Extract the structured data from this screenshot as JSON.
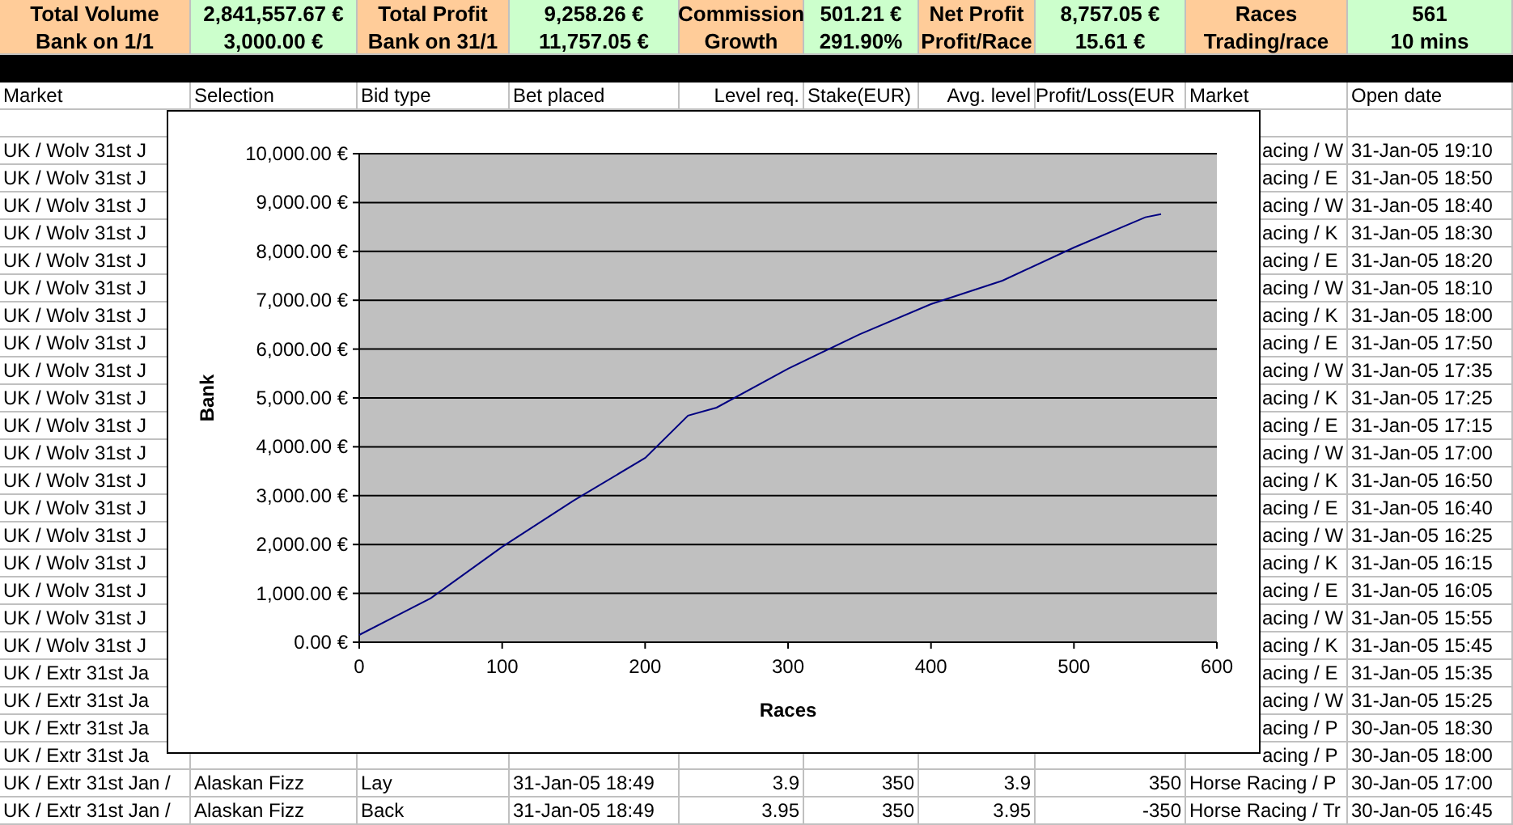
{
  "summary": [
    {
      "labels": [
        "Total Volume",
        "Bank on 1/1"
      ],
      "values": [
        "2,841,557.67 €",
        "3,000.00 €"
      ]
    },
    {
      "labels": [
        "Total Profit",
        "Bank on 31/1"
      ],
      "values": [
        "9,258.26 €",
        "11,757.05 €"
      ]
    },
    {
      "labels": [
        "Commission",
        "Growth"
      ],
      "values": [
        "501.21 €",
        "291.90%"
      ]
    },
    {
      "labels": [
        "Net Profit",
        "Profit/Race"
      ],
      "values": [
        "8,757.05 €",
        "15.61 €"
      ]
    },
    {
      "labels": [
        "Races",
        "Trading/race"
      ],
      "values": [
        "561",
        "10 mins"
      ]
    }
  ],
  "table": {
    "columns": [
      "Market",
      "Selection",
      "Bid type",
      "Bet placed",
      "Level req.",
      "Stake(EUR)",
      "Avg. level",
      "Profit/Loss(EUR",
      "Market",
      "Open date"
    ],
    "rows": [
      {
        "kind": "covered",
        "market": "UK / Wolv 31st J",
        "market_2": "acing / W",
        "open_date": "31-Jan-05 19:10"
      },
      {
        "kind": "covered",
        "market": "UK / Wolv 31st J",
        "market_2": "acing / E",
        "open_date": "31-Jan-05 18:50"
      },
      {
        "kind": "covered",
        "market": "UK / Wolv 31st J",
        "market_2": "acing / W",
        "open_date": "31-Jan-05 18:40"
      },
      {
        "kind": "covered",
        "market": "UK / Wolv 31st J",
        "market_2": "acing / K",
        "open_date": "31-Jan-05 18:30"
      },
      {
        "kind": "covered",
        "market": "UK / Wolv 31st J",
        "market_2": "acing / E",
        "open_date": "31-Jan-05 18:20"
      },
      {
        "kind": "covered",
        "market": "UK / Wolv 31st J",
        "market_2": "acing / W",
        "open_date": "31-Jan-05 18:10"
      },
      {
        "kind": "covered",
        "market": "UK / Wolv 31st J",
        "market_2": "acing / K",
        "open_date": "31-Jan-05 18:00"
      },
      {
        "kind": "covered",
        "market": "UK / Wolv 31st J",
        "market_2": "acing / E",
        "open_date": "31-Jan-05 17:50"
      },
      {
        "kind": "covered",
        "market": "UK / Wolv 31st J",
        "market_2": "acing / W",
        "open_date": "31-Jan-05 17:35"
      },
      {
        "kind": "covered",
        "market": "UK / Wolv 31st J",
        "market_2": "acing / K",
        "open_date": "31-Jan-05 17:25"
      },
      {
        "kind": "covered",
        "market": "UK / Wolv 31st J",
        "market_2": "acing / E",
        "open_date": "31-Jan-05 17:15"
      },
      {
        "kind": "covered",
        "market": "UK / Wolv 31st J",
        "market_2": "acing / W",
        "open_date": "31-Jan-05 17:00"
      },
      {
        "kind": "covered",
        "market": "UK / Wolv 31st J",
        "market_2": "acing / K",
        "open_date": "31-Jan-05 16:50"
      },
      {
        "kind": "covered",
        "market": "UK / Wolv 31st J",
        "market_2": "acing / E",
        "open_date": "31-Jan-05 16:40"
      },
      {
        "kind": "covered",
        "market": "UK / Wolv 31st J",
        "market_2": "acing / W",
        "open_date": "31-Jan-05 16:25"
      },
      {
        "kind": "covered",
        "market": "UK / Wolv 31st J",
        "market_2": "acing / K",
        "open_date": "31-Jan-05 16:15"
      },
      {
        "kind": "covered",
        "market": "UK / Wolv 31st J",
        "market_2": "acing / E",
        "open_date": "31-Jan-05 16:05"
      },
      {
        "kind": "covered",
        "market": "UK / Wolv 31st J",
        "market_2": "acing / W",
        "open_date": "31-Jan-05 15:55"
      },
      {
        "kind": "covered",
        "market": "UK / Wolv 31st J",
        "market_2": "acing / K",
        "open_date": "31-Jan-05 15:45"
      },
      {
        "kind": "covered",
        "market": "UK / Extr 31st Ja",
        "market_2": "acing / E",
        "open_date": "31-Jan-05 15:35"
      },
      {
        "kind": "covered",
        "market": "UK / Extr 31st Ja",
        "market_2": "acing / W",
        "open_date": "31-Jan-05 15:25"
      },
      {
        "kind": "covered",
        "market": "UK / Extr 31st Ja",
        "market_2": "acing / P",
        "open_date": "30-Jan-05 18:30"
      },
      {
        "kind": "covered",
        "market": "UK / Extr 31st Ja",
        "market_2": "acing / P",
        "open_date": "30-Jan-05 18:00"
      },
      {
        "kind": "full",
        "cells": [
          "UK / Extr 31st Jan /",
          "Alaskan Fizz",
          "Lay",
          "31-Jan-05 18:49",
          "3.9",
          "350",
          "3.9",
          "350",
          "Horse Racing / P",
          "30-Jan-05 17:00"
        ]
      },
      {
        "kind": "full",
        "cells": [
          "UK / Extr 31st Jan /",
          "Alaskan Fizz",
          "Back",
          "31-Jan-05 18:49",
          "3.95",
          "350",
          "3.95",
          "-350",
          "Horse Racing / Tr",
          "30-Jan-05 16:45"
        ]
      }
    ]
  },
  "chart": {
    "chart_data": {
      "type": "line",
      "xlabel": "Races",
      "ylabel": "Bank",
      "x": [
        0,
        50,
        100,
        150,
        200,
        230,
        250,
        300,
        350,
        400,
        450,
        500,
        550,
        561
      ],
      "grid": true,
      "series": [
        {
          "color": "#000080",
          "values": [
            150,
            900,
            1950,
            2900,
            3770,
            4640,
            4800,
            5600,
            6300,
            6920,
            7400,
            8080,
            8700,
            8760
          ]
        }
      ],
      "xlim": [
        0,
        600
      ],
      "ylim": [
        0,
        10000
      ],
      "xticks": [
        0,
        100,
        200,
        300,
        400,
        500,
        600
      ],
      "yticks": [
        {
          "value": 0,
          "label": "0.00 €"
        },
        {
          "value": 1000,
          "label": "1,000.00 €"
        },
        {
          "value": 2000,
          "label": "2,000.00 €"
        },
        {
          "value": 3000,
          "label": "3,000.00 €"
        },
        {
          "value": 4000,
          "label": "4,000.00 €"
        },
        {
          "value": 5000,
          "label": "5,000.00 €"
        },
        {
          "value": 6000,
          "label": "6,000.00 €"
        },
        {
          "value": 7000,
          "label": "7,000.00 €"
        },
        {
          "value": 8000,
          "label": "8,000.00 €"
        },
        {
          "value": 9000,
          "label": "9,000.00 €"
        },
        {
          "value": 10000,
          "label": "10,000.00 €"
        }
      ]
    }
  }
}
